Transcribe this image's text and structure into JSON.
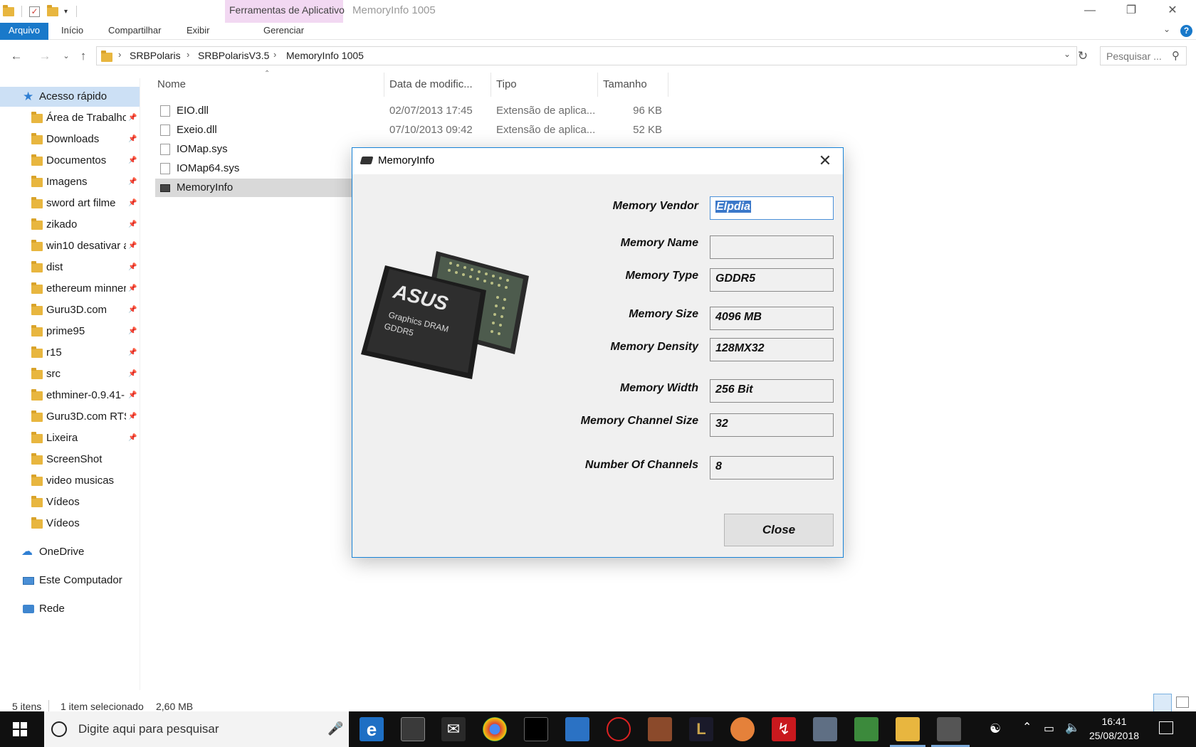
{
  "titlebar": {
    "context_tab": "Ferramentas de Aplicativo",
    "window_title": "MemoryInfo 1005"
  },
  "ribbon": {
    "tabs": [
      "Arquivo",
      "Início",
      "Compartilhar",
      "Exibir",
      "Gerenciar"
    ]
  },
  "address": {
    "crumbs": [
      "SRBPolaris",
      "SRBPolarisV3.5",
      "MemoryInfo 1005"
    ],
    "search_placeholder": "Pesquisar ..."
  },
  "nav": {
    "quick_access": "Acesso rápido",
    "items": [
      {
        "label": "Área de Trabalho",
        "pinned": true
      },
      {
        "label": "Downloads",
        "pinned": true
      },
      {
        "label": "Documentos",
        "pinned": true
      },
      {
        "label": "Imagens",
        "pinned": true
      },
      {
        "label": "sword art filme",
        "pinned": true
      },
      {
        "label": "zikado",
        "pinned": true
      },
      {
        "label": "win10 desativar a",
        "pinned": true
      },
      {
        "label": "dist",
        "pinned": true
      },
      {
        "label": "ethereum minner",
        "pinned": true
      },
      {
        "label": "Guru3D.com",
        "pinned": true
      },
      {
        "label": "prime95",
        "pinned": true
      },
      {
        "label": "r15",
        "pinned": true
      },
      {
        "label": "src",
        "pinned": true
      },
      {
        "label": "ethminer-0.9.41-",
        "pinned": true
      },
      {
        "label": "Guru3D.com RTS",
        "pinned": true
      },
      {
        "label": "Lixeira",
        "pinned": true
      },
      {
        "label": "ScreenShot",
        "pinned": false
      },
      {
        "label": "video musicas",
        "pinned": false
      },
      {
        "label": "Vídeos",
        "pinned": false
      },
      {
        "label": "Vídeos",
        "pinned": false
      }
    ],
    "onedrive": "OneDrive",
    "this_pc": "Este Computador",
    "network": "Rede"
  },
  "files": {
    "columns": [
      "Nome",
      "Data de modific...",
      "Tipo",
      "Tamanho"
    ],
    "rows": [
      {
        "name": "EIO.dll",
        "date": "02/07/2013 17:45",
        "type": "Extensão de aplica...",
        "size": "96 KB"
      },
      {
        "name": "Exeio.dll",
        "date": "07/10/2013 09:42",
        "type": "Extensão de aplica...",
        "size": "52 KB"
      },
      {
        "name": "IOMap.sys",
        "date": "",
        "type": "",
        "size": ""
      },
      {
        "name": "IOMap64.sys",
        "date": "",
        "type": "",
        "size": ""
      },
      {
        "name": "MemoryInfo",
        "date": "",
        "type": "",
        "size": ""
      }
    ]
  },
  "status": {
    "items": "5 itens",
    "selected": "1 item selecionado",
    "size": "2,60 MB"
  },
  "taskbar": {
    "search_placeholder": "Digite aqui para pesquisar",
    "time": "16:41",
    "date": "25/08/2018"
  },
  "dialog": {
    "title": "MemoryInfo",
    "image_text": {
      "brand": "ASUS",
      "line1": "Graphics DRAM",
      "line2": "GDDR5"
    },
    "fields": [
      {
        "label": "Memory Vendor",
        "value": "Elpdia"
      },
      {
        "label": "Memory Name",
        "value": ""
      },
      {
        "label": "Memory Type",
        "value": "GDDR5"
      },
      {
        "label": "Memory Size",
        "value": "4096 MB"
      },
      {
        "label": "Memory Density",
        "value": "128MX32"
      },
      {
        "label": "Memory Width",
        "value": "256 Bit"
      },
      {
        "label": "Memory Channel Size",
        "value": "32"
      },
      {
        "label": "Number Of Channels",
        "value": "8"
      }
    ],
    "close_label": "Close"
  },
  "colors": {
    "accent": "#1979ca",
    "context_tab": "#f2d8f2",
    "selection": "#cce0f5",
    "taskbar": "#101010"
  }
}
